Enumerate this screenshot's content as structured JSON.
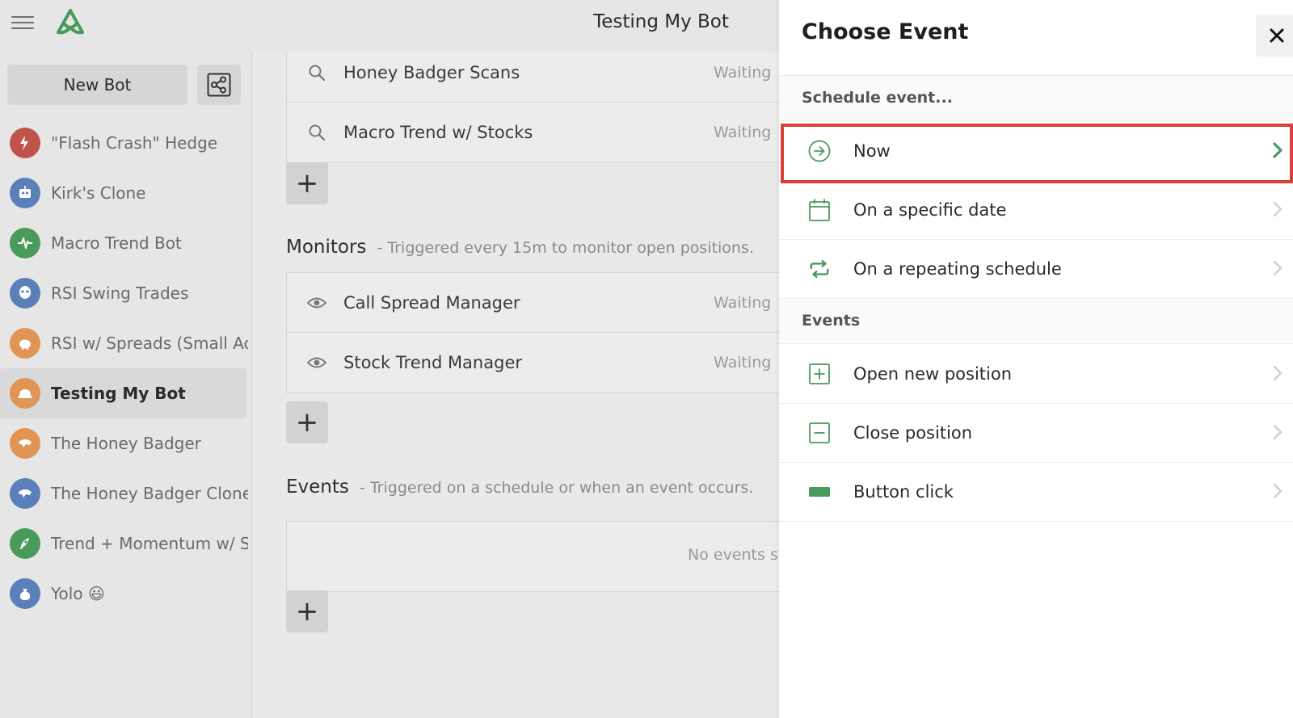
{
  "header": {
    "title": "Testing My Bot"
  },
  "sidebar": {
    "new_bot_label": "New Bot",
    "bots": [
      {
        "label": "\"Flash Crash\" Hedge",
        "color": "#c1544a",
        "icon": "lightning-icon"
      },
      {
        "label": "Kirk's Clone",
        "color": "#5b7fb8",
        "icon": "robot-icon"
      },
      {
        "label": "Macro Trend Bot",
        "color": "#4a9a5c",
        "icon": "pulse-icon"
      },
      {
        "label": "RSI Swing Trades",
        "color": "#5b7fb8",
        "icon": "alien-icon"
      },
      {
        "label": "RSI w/ Spreads (Small Acc",
        "color": "#e09555",
        "icon": "piggy-bank-icon"
      },
      {
        "label": "Testing My Bot",
        "color": "#e09555",
        "icon": "hard-hat-icon",
        "active": true
      },
      {
        "label": "The Honey Badger",
        "color": "#e09555",
        "icon": "badger-icon"
      },
      {
        "label": "The Honey Badger Clone",
        "color": "#5b7fb8",
        "icon": "badger-icon"
      },
      {
        "label": "Trend + Momentum w/ S",
        "color": "#4a9a5c",
        "icon": "rocket-icon"
      },
      {
        "label": "Yolo 😃",
        "color": "#5b7fb8",
        "icon": "money-bag-icon"
      }
    ]
  },
  "main": {
    "scans": [
      {
        "label": "Honey Badger Scans",
        "status": "Waiting"
      },
      {
        "label": "Macro Trend w/ Stocks",
        "status": "Waiting"
      }
    ],
    "monitors": {
      "title": "Monitors",
      "desc": "- Triggered every 15m to monitor open positions.",
      "items": [
        {
          "label": "Call Spread Manager",
          "status": "Waiting"
        },
        {
          "label": "Stock Trend Manager",
          "status": "Waiting"
        }
      ]
    },
    "events": {
      "title": "Events",
      "desc": "- Triggered on a schedule or when an event occurs.",
      "empty_text": "No events s"
    },
    "plus": "+"
  },
  "panel": {
    "title": "Choose Event",
    "schedule_heading": "Schedule event...",
    "schedule_options": [
      {
        "label": "Now",
        "icon": "arrow-circle-icon"
      },
      {
        "label": "On a specific date",
        "icon": "calendar-icon"
      },
      {
        "label": "On a repeating schedule",
        "icon": "repeat-icon"
      }
    ],
    "events_heading": "Events",
    "event_options": [
      {
        "label": "Open new position",
        "icon": "plus-square-icon"
      },
      {
        "label": "Close position",
        "icon": "minus-square-icon"
      },
      {
        "label": "Button click",
        "icon": "button-icon"
      }
    ]
  },
  "colors": {
    "accent": "#4a9a5c",
    "highlight": "#d8403b"
  }
}
